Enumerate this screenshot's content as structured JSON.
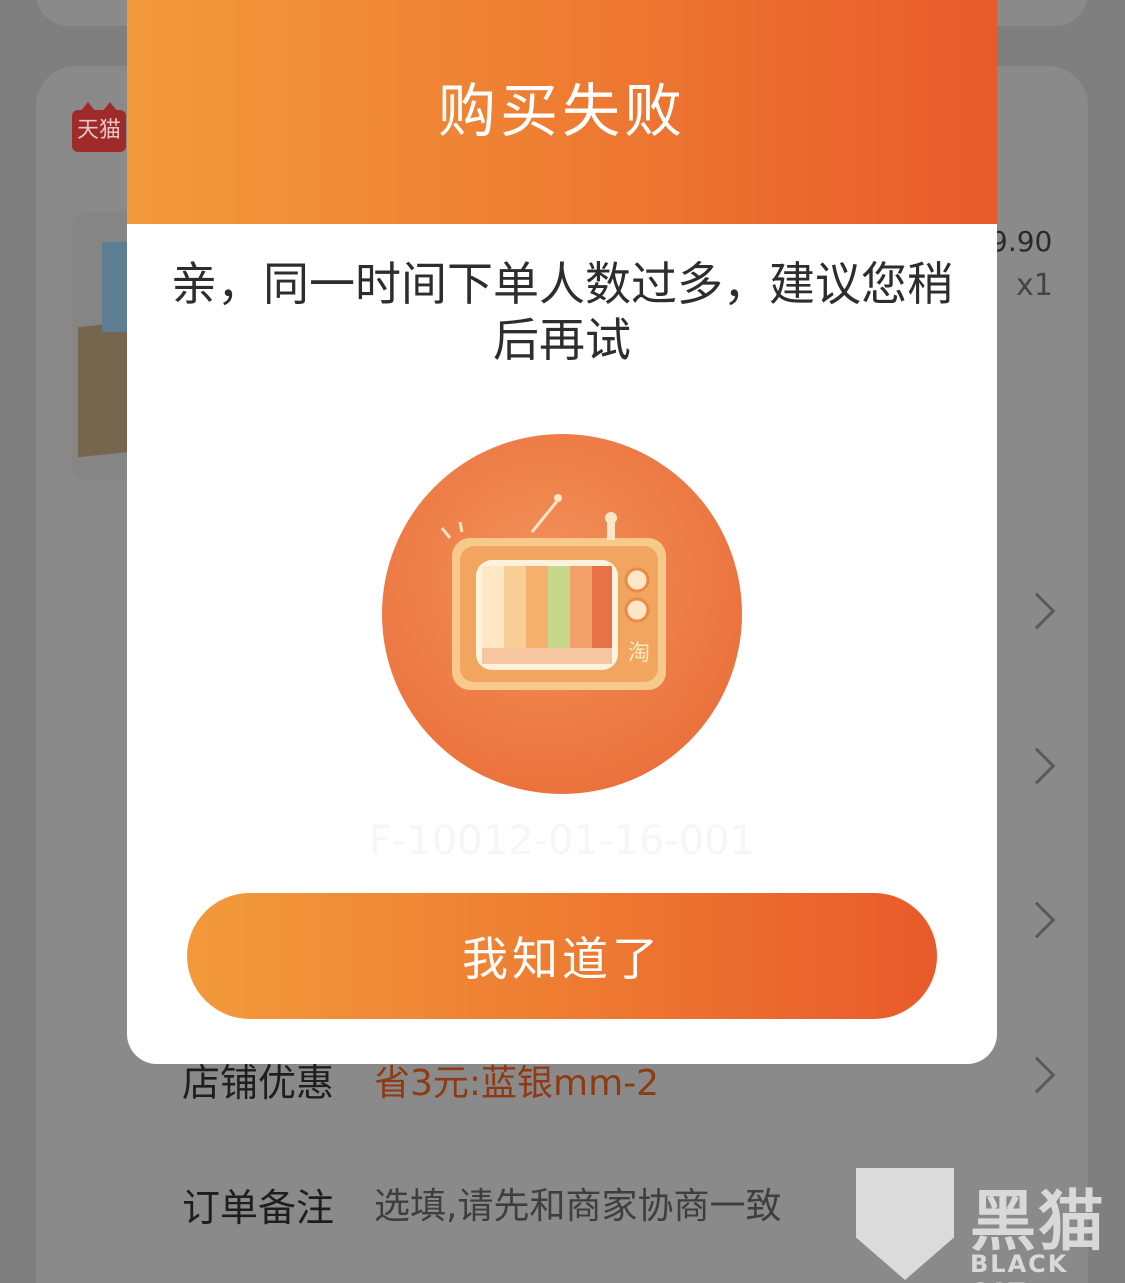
{
  "background": {
    "store_badge": "天猫",
    "product": {
      "price": "9.90",
      "quantity": "x1"
    },
    "rows": [
      {
        "label": "店铺优惠",
        "value": "省3元:蓝银mm-2"
      },
      {
        "label": "订单备注",
        "value": "选填,请先和商家协商一致"
      }
    ]
  },
  "dialog": {
    "title": "购买失败",
    "message": "亲，同一时间下单人数过多，建议您稍后再试",
    "illustration_badge": "淘",
    "error_code": "F-10012-01-16-001",
    "confirm_button": "我知道了"
  },
  "watermark": {
    "title": "黑猫",
    "subtitle": "BLACK CAT"
  },
  "colors": {
    "accent_start": "#f29a3b",
    "accent_end": "#e85a2b",
    "promo_text": "#8e3a12"
  }
}
